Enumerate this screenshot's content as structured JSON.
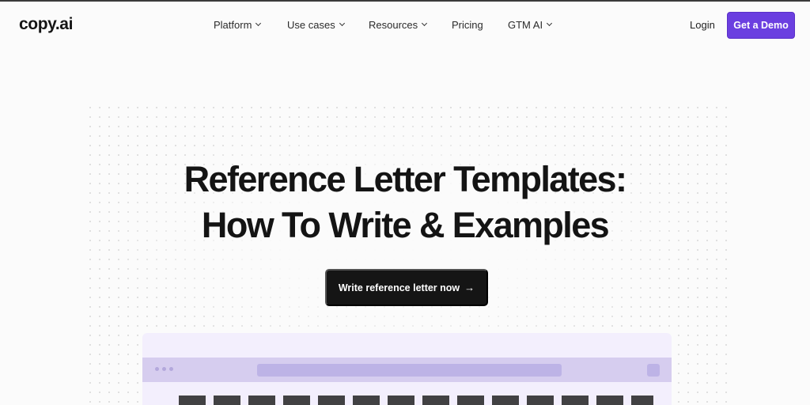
{
  "header": {
    "logo": "copy.ai",
    "nav": [
      {
        "label": "Platform",
        "dropdown": true
      },
      {
        "label": "Use cases",
        "dropdown": true
      },
      {
        "label": "Resources",
        "dropdown": true
      },
      {
        "label": "Pricing",
        "dropdown": false
      },
      {
        "label": "GTM AI",
        "dropdown": true
      }
    ],
    "login": "Login",
    "demo": "Get a Demo"
  },
  "hero": {
    "title_line1": "Reference Letter Templates:",
    "title_line2": "How To Write & Examples",
    "cta": "Write reference letter now",
    "cta_arrow": "→"
  },
  "colors": {
    "accent": "#6b3fe0",
    "cta_bg": "#151515",
    "preview_bg": "#f3effd",
    "preview_bar": "#d6cdef"
  }
}
